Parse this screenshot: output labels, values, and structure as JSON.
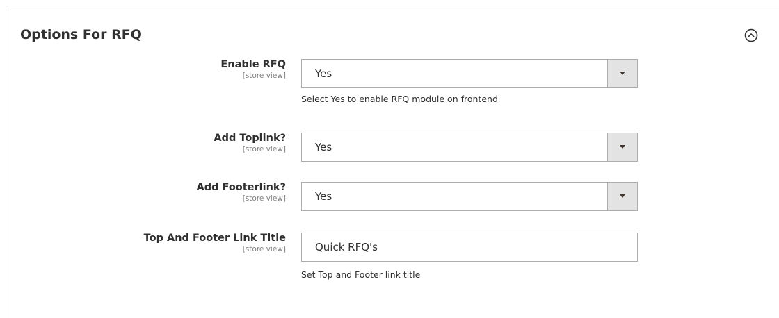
{
  "section": {
    "title": "Options For RFQ",
    "collapse_icon": "chevron-up-circle-icon"
  },
  "fields": {
    "enable_rfq": {
      "label": "Enable RFQ",
      "scope": "[store view]",
      "value": "Yes",
      "note": "Select Yes to enable RFQ module on frontend"
    },
    "add_toplink": {
      "label": "Add Toplink?",
      "scope": "[store view]",
      "value": "Yes"
    },
    "add_footerlink": {
      "label": "Add Footerlink?",
      "scope": "[store view]",
      "value": "Yes"
    },
    "link_title": {
      "label": "Top And Footer Link Title",
      "scope": "[store view]",
      "value": "Quick RFQ's",
      "note": "Set Top and Footer link title"
    }
  }
}
